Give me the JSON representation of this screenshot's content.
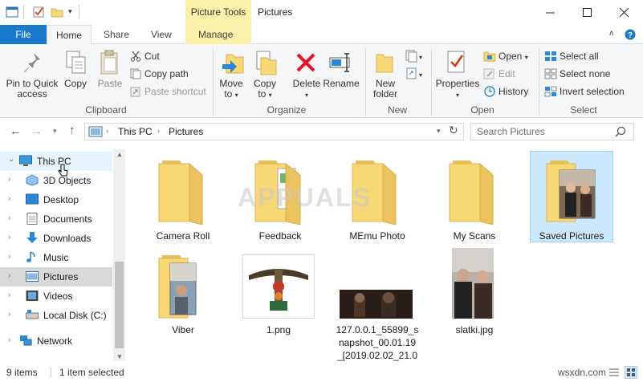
{
  "window": {
    "title": "Pictures",
    "context_tab_group": "Picture Tools"
  },
  "ribbon_tabs": {
    "file": "File",
    "home": "Home",
    "share": "Share",
    "view": "View",
    "manage": "Manage"
  },
  "clipboard": {
    "pin_line1": "Pin to Quick",
    "pin_line2": "access",
    "copy": "Copy",
    "paste": "Paste",
    "cut": "Cut",
    "copy_path": "Copy path",
    "paste_shortcut": "Paste shortcut",
    "group": "Clipboard"
  },
  "organize": {
    "move_line1": "Move",
    "move_line2": "to",
    "copy_line1": "Copy",
    "copy_line2": "to",
    "delete": "Delete",
    "rename": "Rename",
    "group": "Organize"
  },
  "new": {
    "folder_line1": "New",
    "folder_line2": "folder",
    "group": "New"
  },
  "open": {
    "properties": "Properties",
    "open": "Open",
    "edit": "Edit",
    "history": "History",
    "group": "Open"
  },
  "select": {
    "all": "Select all",
    "none": "Select none",
    "invert": "Invert selection",
    "group": "Select"
  },
  "address": {
    "path": [
      "This PC",
      "Pictures"
    ]
  },
  "search": {
    "placeholder": "Search Pictures"
  },
  "nav": {
    "items": [
      {
        "label": "This PC",
        "icon": "pc-icon"
      },
      {
        "label": "3D Objects",
        "icon": "3d-objects-icon"
      },
      {
        "label": "Desktop",
        "icon": "desktop-icon"
      },
      {
        "label": "Documents",
        "icon": "documents-icon"
      },
      {
        "label": "Downloads",
        "icon": "downloads-icon"
      },
      {
        "label": "Music",
        "icon": "music-icon"
      },
      {
        "label": "Pictures",
        "icon": "pictures-icon"
      },
      {
        "label": "Videos",
        "icon": "videos-icon"
      },
      {
        "label": "Local Disk (C:)",
        "icon": "disk-icon"
      },
      {
        "label": "Network",
        "icon": "network-icon"
      }
    ]
  },
  "files": [
    {
      "name": "Camera Roll",
      "type": "folder"
    },
    {
      "name": "Feedback",
      "type": "folder"
    },
    {
      "name": "MEmu Photo",
      "type": "folder"
    },
    {
      "name": "My Scans",
      "type": "folder"
    },
    {
      "name": "Saved Pictures",
      "type": "folder",
      "selected": true
    },
    {
      "name": "Viber",
      "type": "folder"
    },
    {
      "name": "1.png",
      "type": "image"
    },
    {
      "name_line1": "127.0.0.1_55899_s",
      "name_line2": "napshot_00.01.19",
      "name_line3": "_[2019.02.02_21.0",
      "type": "image"
    },
    {
      "name": "slatki.jpg",
      "type": "image"
    }
  ],
  "status": {
    "count": "9 items",
    "selection": "1 item selected"
  },
  "watermarks": {
    "center": "APPUALS",
    "corner": "wsxdn.com"
  },
  "colors": {
    "accent": "#1979ca",
    "context_tab": "#faf1a9",
    "selection": "#cce8ff",
    "folder": "#f8d775"
  }
}
